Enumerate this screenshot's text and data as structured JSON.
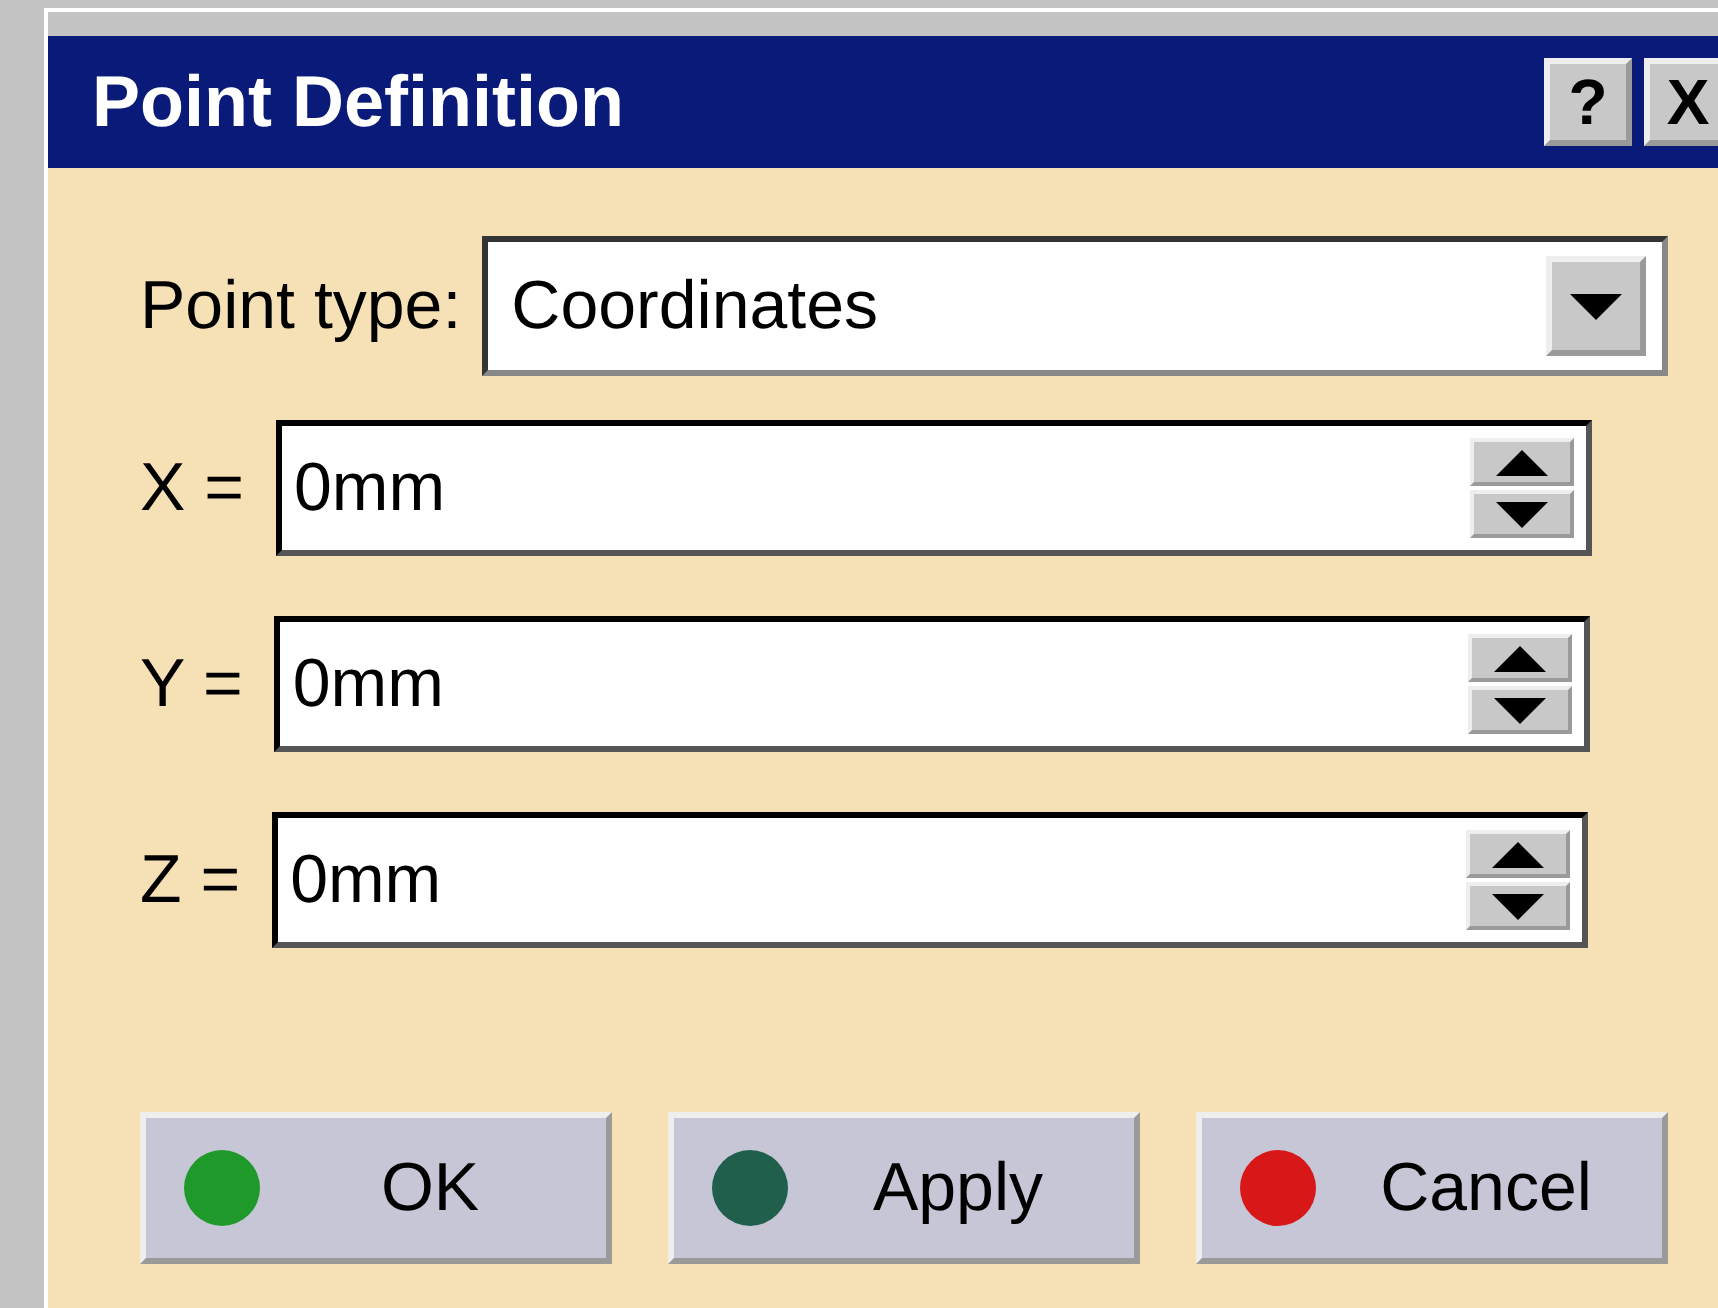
{
  "window": {
    "title": "Point Definition",
    "help_button": "?",
    "close_button": "X"
  },
  "point_type": {
    "label": "Point type:",
    "value": "Coordinates"
  },
  "fields": [
    {
      "label": "X =",
      "value": "0mm"
    },
    {
      "label": "Y =",
      "value": "0mm"
    },
    {
      "label": "Z =",
      "value": "0mm"
    }
  ],
  "buttons": [
    {
      "label": "OK",
      "color": "#1f9a2a"
    },
    {
      "label": "Apply",
      "color": "#1f5f4c"
    },
    {
      "label": "Cancel",
      "color": "#d81818"
    }
  ]
}
